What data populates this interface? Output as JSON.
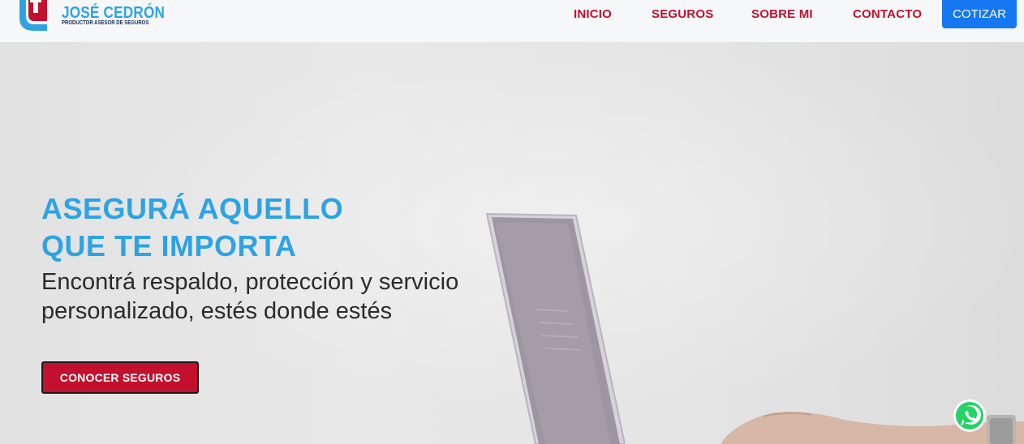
{
  "header": {
    "logo": {
      "name": "JOSÉ CEDRÓN",
      "tagline": "PRODUCTOR ASESOR DE SEGUROS",
      "icon": "logo-mark-icon"
    },
    "nav": [
      {
        "label": "INICIO"
      },
      {
        "label": "SEGUROS"
      },
      {
        "label": "SOBRE MI"
      },
      {
        "label": "CONTACTO"
      }
    ],
    "cta": {
      "label": "COTIZAR"
    }
  },
  "hero": {
    "title_line1": "ASEGURÁ AQUELLO",
    "title_line2": "QUE TE IMPORTA",
    "subtitle": "Encontrá respaldo, protección y servicio personalizado, estés donde estés",
    "button": {
      "label": "CONOCER SEGUROS"
    }
  },
  "floating": {
    "whatsapp_icon": "whatsapp-icon"
  },
  "colors": {
    "brand_blue": "#2ea3e3",
    "brand_red": "#c2102e",
    "cta_blue": "#1577f2",
    "header_bg": "#f6f7f9",
    "whatsapp_green": "#25d366"
  }
}
